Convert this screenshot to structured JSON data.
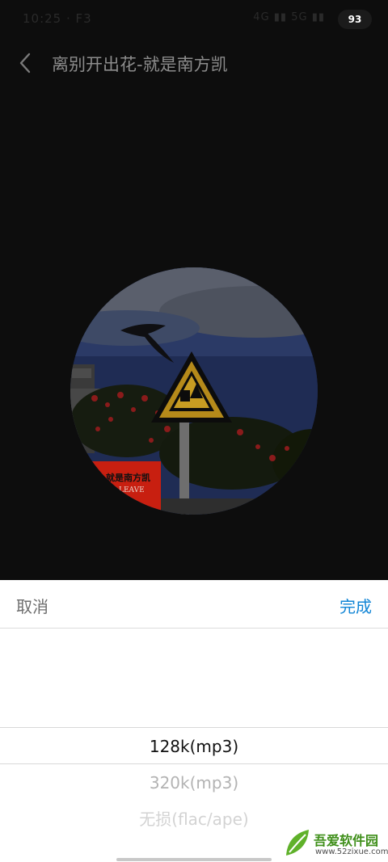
{
  "status_bar": {
    "time": "10:25 · F3",
    "right_indicators": "4G ▮▮ 5G ▮▮",
    "battery": "93"
  },
  "header": {
    "title": "离别开出花-就是南方凯"
  },
  "album_art": {
    "cover_text_cn": "就是南方凯",
    "cover_text_en": "LEAVE"
  },
  "sheet": {
    "cancel_label": "取消",
    "done_label": "完成",
    "options": [
      "128k(mp3)",
      "320k(mp3)",
      "无损(flac/ape)"
    ],
    "selected_index": 0
  },
  "watermark": {
    "title": "吾爱软件园",
    "url": "www.52zixue.com"
  },
  "colors": {
    "background": "#0d0d0d",
    "accent": "#1185d6",
    "sheet": "#ffffff",
    "watermark_green": "#3f8f1a"
  },
  "icons": [
    "back-arrow-icon",
    "battery-icon",
    "signal-icon"
  ]
}
